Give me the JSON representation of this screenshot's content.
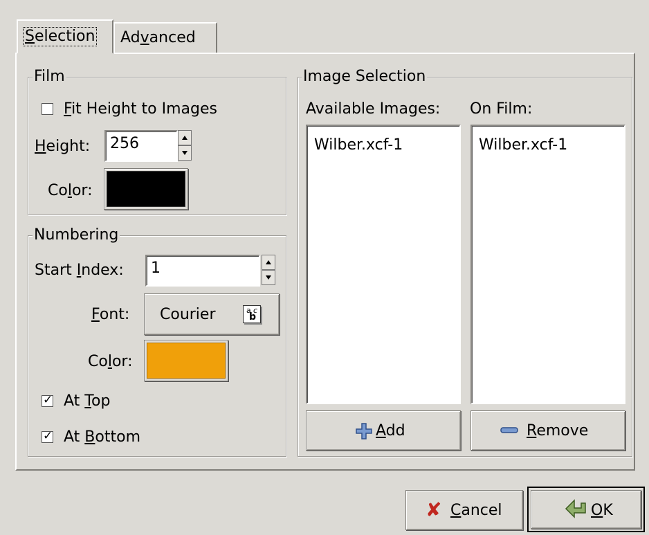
{
  "tabs": [
    {
      "label_pre": "",
      "label_u": "S",
      "label_post": "election"
    },
    {
      "label_pre": "Ad",
      "label_u": "v",
      "label_post": "anced"
    }
  ],
  "film": {
    "title": "Film",
    "fit_pre": "",
    "fit_u": "F",
    "fit_post": "it Height to Images",
    "fit_checked": false,
    "height_pre": "",
    "height_u": "H",
    "height_post": "eight:",
    "height_value": "256",
    "color_pre": "Co",
    "color_u": "l",
    "color_post": "or:",
    "color_hex": "#000000"
  },
  "numbering": {
    "title": "Numbering",
    "start_pre": "Start ",
    "start_u": "I",
    "start_post": "ndex:",
    "start_value": "1",
    "font_pre": "",
    "font_u": "F",
    "font_post": "ont:",
    "font_value": "Courier",
    "color_pre": "Co",
    "color_u": "l",
    "color_post": "or:",
    "color_hex": "#f0a00a",
    "top_pre": "At ",
    "top_u": "T",
    "top_post": "op",
    "top_checked": true,
    "bottom_pre": "At ",
    "bottom_u": "B",
    "bottom_post": "ottom",
    "bottom_checked": true
  },
  "image_selection": {
    "title": "Image Selection",
    "available_label": "Available Images:",
    "onfilm_label": "On Film:",
    "available_items": [
      "Wilber.xcf-1"
    ],
    "onfilm_items": [
      "Wilber.xcf-1"
    ],
    "add_u": "A",
    "add_post": "dd",
    "remove_u": "R",
    "remove_post": "emove"
  },
  "dialog": {
    "cancel_u": "C",
    "cancel_post": "ancel",
    "ok_u": "O",
    "ok_post": "K"
  }
}
